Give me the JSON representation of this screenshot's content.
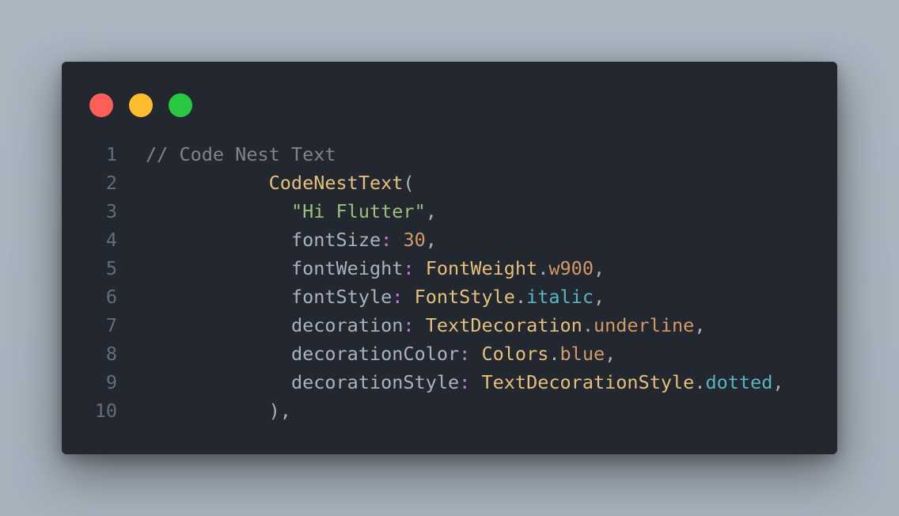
{
  "window": {
    "controls": {
      "close_color": "#ff5f57",
      "minimize_color": "#febc2e",
      "maximize_color": "#28c840"
    }
  },
  "editor": {
    "lines": [
      {
        "number": "1",
        "indent": "",
        "tokens": [
          {
            "t": "// Code Nest Text",
            "c": "comment"
          }
        ]
      },
      {
        "number": "2",
        "indent": "           ",
        "tokens": [
          {
            "t": "CodeNestText",
            "c": "class"
          },
          {
            "t": "(",
            "c": "punc"
          }
        ]
      },
      {
        "number": "3",
        "indent": "             ",
        "tokens": [
          {
            "t": "\"Hi Flutter\"",
            "c": "str"
          },
          {
            "t": ",",
            "c": "punc"
          }
        ]
      },
      {
        "number": "4",
        "indent": "             ",
        "tokens": [
          {
            "t": "fontSize",
            "c": "prop"
          },
          {
            "t": ":",
            "c": "colon"
          },
          {
            "t": " ",
            "c": "punc"
          },
          {
            "t": "30",
            "c": "num"
          },
          {
            "t": ",",
            "c": "punc"
          }
        ]
      },
      {
        "number": "5",
        "indent": "             ",
        "tokens": [
          {
            "t": "fontWeight",
            "c": "prop"
          },
          {
            "t": ":",
            "c": "colon"
          },
          {
            "t": " ",
            "c": "punc"
          },
          {
            "t": "FontWeight",
            "c": "class"
          },
          {
            "t": ".",
            "c": "punc"
          },
          {
            "t": "w900",
            "c": "member"
          },
          {
            "t": ",",
            "c": "punc"
          }
        ]
      },
      {
        "number": "6",
        "indent": "             ",
        "tokens": [
          {
            "t": "fontStyle",
            "c": "prop"
          },
          {
            "t": ":",
            "c": "colon"
          },
          {
            "t": " ",
            "c": "punc"
          },
          {
            "t": "FontStyle",
            "c": "class"
          },
          {
            "t": ".",
            "c": "punc"
          },
          {
            "t": "italic",
            "c": "cyan"
          },
          {
            "t": ",",
            "c": "punc"
          }
        ]
      },
      {
        "number": "7",
        "indent": "             ",
        "tokens": [
          {
            "t": "decoration",
            "c": "prop"
          },
          {
            "t": ":",
            "c": "colon"
          },
          {
            "t": " ",
            "c": "punc"
          },
          {
            "t": "TextDecoration",
            "c": "class"
          },
          {
            "t": ".",
            "c": "punc"
          },
          {
            "t": "underline",
            "c": "member"
          },
          {
            "t": ",",
            "c": "punc"
          }
        ]
      },
      {
        "number": "8",
        "indent": "             ",
        "tokens": [
          {
            "t": "decorationColor",
            "c": "prop"
          },
          {
            "t": ":",
            "c": "colon"
          },
          {
            "t": " ",
            "c": "punc"
          },
          {
            "t": "Colors",
            "c": "class"
          },
          {
            "t": ".",
            "c": "punc"
          },
          {
            "t": "blue",
            "c": "member"
          },
          {
            "t": ",",
            "c": "punc"
          }
        ]
      },
      {
        "number": "9",
        "indent": "             ",
        "tokens": [
          {
            "t": "decorationStyle",
            "c": "prop"
          },
          {
            "t": ":",
            "c": "colon"
          },
          {
            "t": " ",
            "c": "punc"
          },
          {
            "t": "TextDecorationStyle",
            "c": "class"
          },
          {
            "t": ".",
            "c": "punc"
          },
          {
            "t": "dotted",
            "c": "cyan"
          },
          {
            "t": ",",
            "c": "punc"
          }
        ]
      },
      {
        "number": "10",
        "indent": "           ",
        "tokens": [
          {
            "t": "),",
            "c": "punc"
          }
        ]
      }
    ]
  },
  "colors": {
    "background": "#a9b4bf",
    "editor_bg": "#23272f",
    "line_number": "#636d7c",
    "comment": "#7f848e",
    "class": "#e5c07b",
    "string": "#98c379",
    "number": "#d19a66",
    "keyword_colon": "#c678dd",
    "cyan": "#56b6c2"
  }
}
